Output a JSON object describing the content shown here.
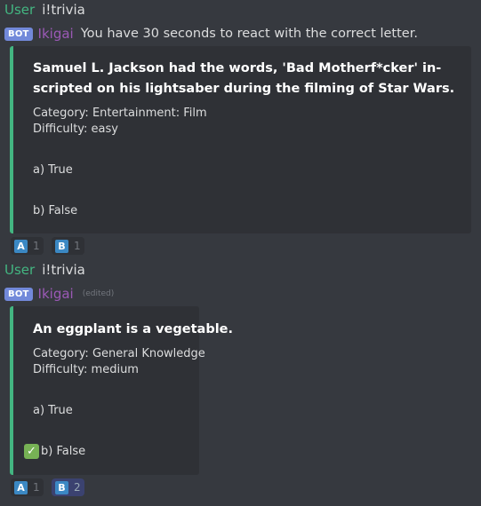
{
  "messages": [
    {
      "user": {
        "name": "User",
        "text": "i!trivia"
      },
      "bot": {
        "tag": "BOT",
        "name": "Ikigai",
        "text": "You have 30 seconds to react with the correct letter."
      },
      "embed": {
        "title": "Samuel L. Jackson had the words, 'Bad Motherf*cker' in-scripted on his lightsaber during the filming of Star Wars.",
        "category": "Category: Entertainment: Film",
        "difficulty": "Difficulty: easy",
        "option_a": "a) True",
        "option_b": "b) False",
        "accent_color": "#43b581"
      },
      "reactions": [
        {
          "emoji": "A",
          "count": "1",
          "reacted": false
        },
        {
          "emoji": "B",
          "count": "1",
          "reacted": false
        }
      ]
    },
    {
      "user": {
        "name": "User",
        "text": "i!trivia"
      },
      "bot": {
        "tag": "BOT",
        "name": "Ikigai",
        "edited": "(edited)"
      },
      "embed": {
        "title": "An eggplant is a vegetable.",
        "category": "Category: General Knowledge",
        "difficulty": "Difficulty: medium",
        "option_a": "a) True",
        "option_b": "b) False",
        "correct_icon": "white-check-mark-icon",
        "accent_color": "#43b581"
      },
      "reactions": [
        {
          "emoji": "A",
          "count": "1",
          "reacted": false
        },
        {
          "emoji": "B",
          "count": "2",
          "reacted": true
        }
      ]
    }
  ]
}
